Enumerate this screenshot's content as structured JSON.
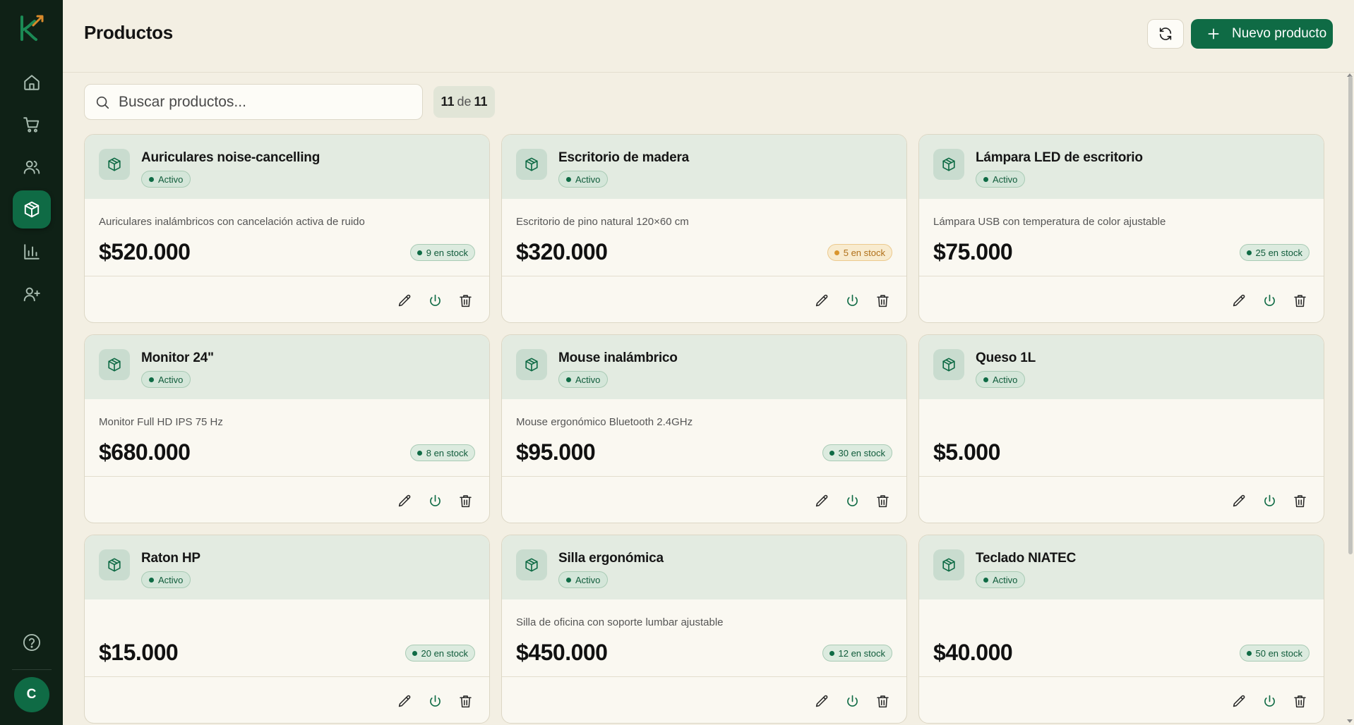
{
  "header": {
    "title": "Productos",
    "new_button_label": "Nuevo producto"
  },
  "search": {
    "placeholder": "Buscar productos...",
    "value": ""
  },
  "count": {
    "shown": "11",
    "sep": "de",
    "total": "11"
  },
  "sidebar": {
    "items": [
      {
        "name": "home-icon"
      },
      {
        "name": "cart-icon"
      },
      {
        "name": "users-icon"
      },
      {
        "name": "box-icon",
        "active": true
      },
      {
        "name": "chart-icon"
      },
      {
        "name": "user-plus-icon"
      }
    ],
    "avatar_initial": "C"
  },
  "colors": {
    "accent": "#0f6b45",
    "sidebar": "#0f2116",
    "background": "#f3efe3"
  },
  "products": [
    {
      "name": "Auriculares noise-cancelling",
      "status": "Activo",
      "description": "Auriculares inalámbricos con cancelación activa de ruido",
      "price": "$520.000",
      "stock": "9 en stock",
      "low": false
    },
    {
      "name": "Escritorio de madera",
      "status": "Activo",
      "description": "Escritorio de pino natural 120×60 cm",
      "price": "$320.000",
      "stock": "5 en stock",
      "low": true
    },
    {
      "name": "Lámpara LED de escritorio",
      "status": "Activo",
      "description": "Lámpara USB con temperatura de color ajustable",
      "price": "$75.000",
      "stock": "25 en stock",
      "low": false
    },
    {
      "name": "Monitor 24\"",
      "status": "Activo",
      "description": "Monitor Full HD IPS 75 Hz",
      "price": "$680.000",
      "stock": "8 en stock",
      "low": false
    },
    {
      "name": "Mouse inalámbrico",
      "status": "Activo",
      "description": "Mouse ergonómico Bluetooth 2.4GHz",
      "price": "$95.000",
      "stock": "30 en stock",
      "low": false
    },
    {
      "name": "Queso 1L",
      "status": "Activo",
      "description": "",
      "price": "$5.000",
      "stock": "",
      "low": false
    },
    {
      "name": "Raton HP",
      "status": "Activo",
      "description": "",
      "price": "$15.000",
      "stock": "20 en stock",
      "low": false
    },
    {
      "name": "Silla ergonómica",
      "status": "Activo",
      "description": "Silla de oficina con soporte lumbar ajustable",
      "price": "$450.000",
      "stock": "12 en stock",
      "low": false
    },
    {
      "name": "Teclado NIATEC",
      "status": "Activo",
      "description": "",
      "price": "$40.000",
      "stock": "50 en stock",
      "low": false
    }
  ]
}
